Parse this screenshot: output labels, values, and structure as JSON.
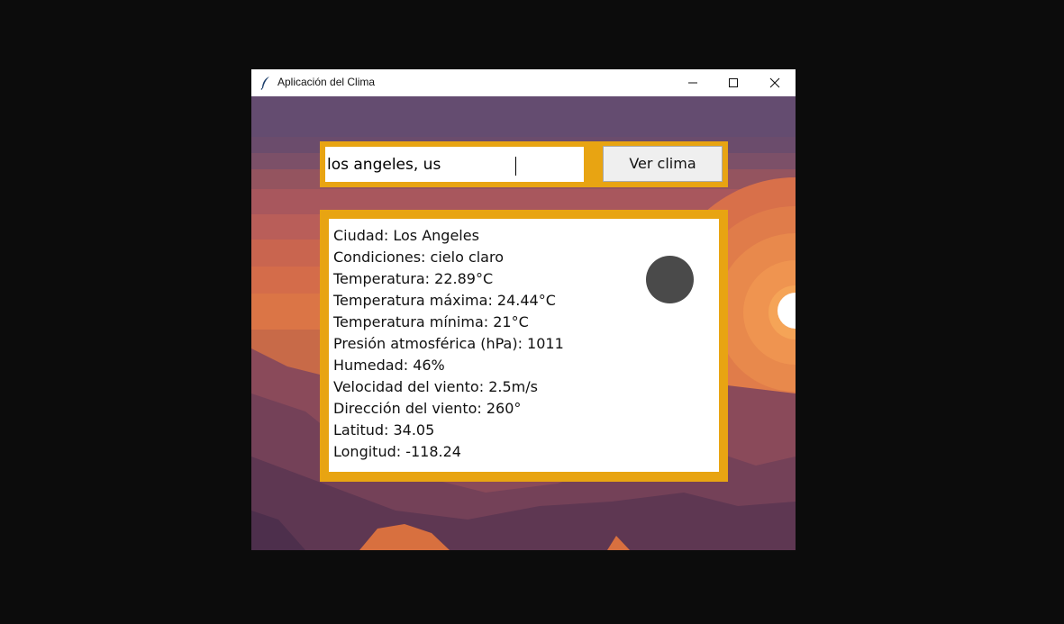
{
  "window": {
    "title": "Aplicación del Clima",
    "app_icon": "feather-icon",
    "controls": [
      "minimize-icon",
      "maximize-icon",
      "close-icon"
    ]
  },
  "search": {
    "value": "los angeles, us",
    "button_label": "Ver clima"
  },
  "weather": {
    "icon": "clear-sky-icon",
    "lines": [
      "Ciudad: Los Angeles",
      "Condiciones: cielo claro",
      "Temperatura: 22.89°C",
      "Temperatura máxima: 24.44°C",
      "Temperatura mínima: 21°C",
      "Presión atmosférica (hPa): 1011",
      "Humedad: 46%",
      "Velocidad del viento: 2.5m/s",
      "Dirección del viento: 260°",
      "Latitud: 34.05",
      "Longitud: -118.24"
    ]
  },
  "colors": {
    "frame_accent": "#e8a412",
    "desktop": "#0c0c0c"
  }
}
